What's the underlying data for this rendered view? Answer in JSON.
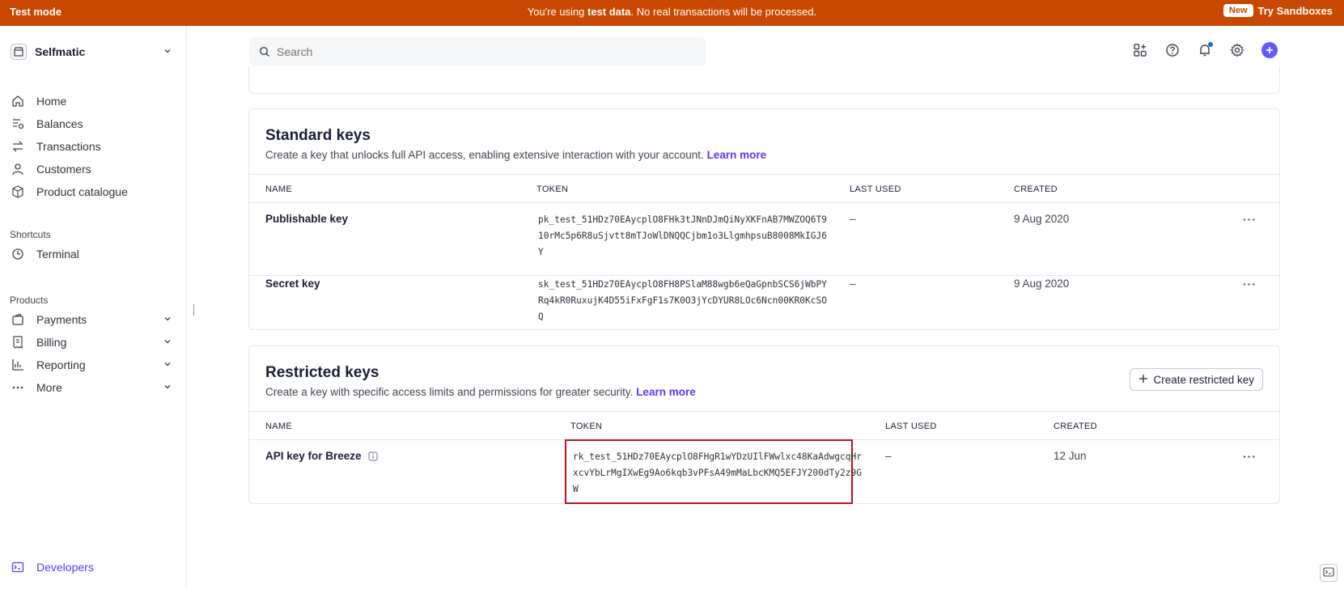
{
  "banner": {
    "mode_label": "Test mode",
    "message_prefix": "You're using ",
    "message_bold": "test data",
    "message_suffix": ". No real transactions will be processed.",
    "new_badge": "New",
    "try_link": "Try Sandboxes",
    "color": "#c84801"
  },
  "sidebar": {
    "account_name": "Selfmatic",
    "main_items": [
      {
        "label": "Home",
        "icon": "home-icon"
      },
      {
        "label": "Balances",
        "icon": "balances-icon"
      },
      {
        "label": "Transactions",
        "icon": "transactions-icon"
      },
      {
        "label": "Customers",
        "icon": "customers-icon"
      },
      {
        "label": "Product catalogue",
        "icon": "product-icon"
      }
    ],
    "shortcuts_title": "Shortcuts",
    "shortcuts": [
      {
        "label": "Terminal",
        "icon": "terminal-icon"
      }
    ],
    "products_title": "Products",
    "products": [
      {
        "label": "Payments",
        "icon": "payments-icon"
      },
      {
        "label": "Billing",
        "icon": "billing-icon"
      },
      {
        "label": "Reporting",
        "icon": "reporting-icon"
      },
      {
        "label": "More",
        "icon": "more-icon"
      }
    ],
    "developers_label": "Developers",
    "accent_color": "#533afd"
  },
  "header": {
    "search_placeholder": "Search"
  },
  "standard_keys": {
    "title": "Standard keys",
    "description": "Create a key that unlocks full API access, enabling extensive interaction with your account.",
    "learn_more": "Learn more",
    "columns": [
      "NAME",
      "TOKEN",
      "LAST USED",
      "CREATED"
    ],
    "rows": [
      {
        "name": "Publishable key",
        "token": "pk_test_51HDz70EAycplO8FHk3tJNnDJmQiNyXKFnAB7MWZOQ6T910rMc5p6R8uSjvtt8mTJoWlDNQQCjbm1o3LlgmhpsuB8008MkIGJ6Y",
        "last_used": "–",
        "created": "9 Aug 2020"
      },
      {
        "name": "Secret key",
        "token": "sk_test_51HDz70EAycplO8FH8PSlaM88wgb6eQaGpnbSCS6jWbPYRq4kR0RuxujK4D55iFxFgF1s7K0O3jYcDYUR8LOc6Ncn00KR0KcSOQ",
        "last_used": "–",
        "created": "9 Aug 2020"
      }
    ]
  },
  "restricted_keys": {
    "title": "Restricted keys",
    "description": "Create a key with specific access limits and permissions for greater security.",
    "learn_more": "Learn more",
    "create_button": "Create restricted key",
    "columns": [
      "NAME",
      "TOKEN",
      "LAST USED",
      "CREATED"
    ],
    "rows": [
      {
        "name": "API key for Breeze",
        "token": "rk_test_51HDz70EAycplO8FHgR1wYDzUIlFWwlxc48KaAdwgcqHrxcvYbLrMgIXwEg9Ao6kqb3vPFsA49mMaLbcKMQ5EFJY200dTy2z9GW",
        "last_used": "–",
        "created": "12 Jun"
      }
    ],
    "highlight_color": "#b3161b"
  }
}
